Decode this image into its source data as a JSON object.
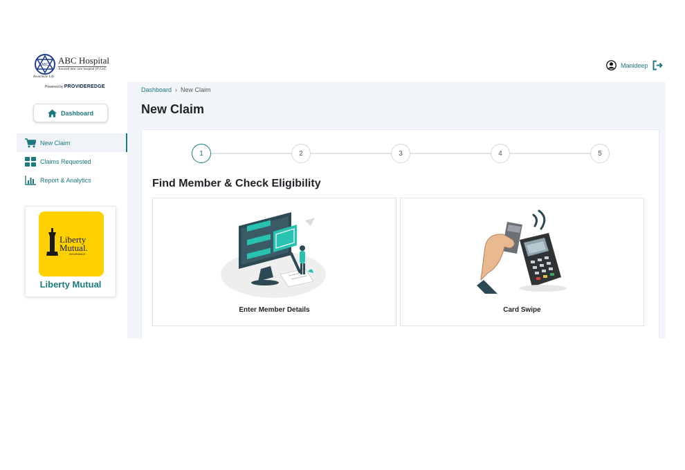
{
  "brand": {
    "hospital_name": "ABC Hospital",
    "hospital_tagline": "Assured best care hospital (P) Ltd.,",
    "motto": "Reanimate Life",
    "emblem_text": "ABC",
    "powered_by_label": "Powered by",
    "powered_by_brand": "PROVIDEREDGE"
  },
  "dashboard_button": {
    "label": "Dashboard",
    "icon": "home-icon"
  },
  "sidebar": {
    "items": [
      {
        "label": "New Claim",
        "icon": "cart-icon",
        "active": true
      },
      {
        "label": "Claims Requested",
        "icon": "grid-icon",
        "active": false
      },
      {
        "label": "Report & Analytics",
        "icon": "bar-chart-icon",
        "active": false
      }
    ]
  },
  "insurer": {
    "name": "Liberty Mutual",
    "logo_text_1": "Liberty",
    "logo_text_2": "Mutual.",
    "logo_text_3": "INSURANCE"
  },
  "user": {
    "name": "Manideep",
    "icon": "user-icon",
    "logout_icon": "logout-icon"
  },
  "breadcrumb": {
    "parent": "Dashboard",
    "separator": "›",
    "current": "New Claim"
  },
  "page": {
    "title": "New Claim",
    "section_title": "Find Member & Check Eligibility"
  },
  "stepper": {
    "steps": [
      "1",
      "2",
      "3",
      "4",
      "5"
    ],
    "active_step": 1
  },
  "options": [
    {
      "label": "Enter Member Details",
      "illustration": "member-details-illustration"
    },
    {
      "label": "Card Swipe",
      "illustration": "card-swipe-illustration"
    }
  ],
  "colors": {
    "accent": "#1b7a7e",
    "main_bg": "#f2f5fa",
    "insurer_yellow": "#ffd000",
    "illustration_teal": "#27c3b0"
  }
}
